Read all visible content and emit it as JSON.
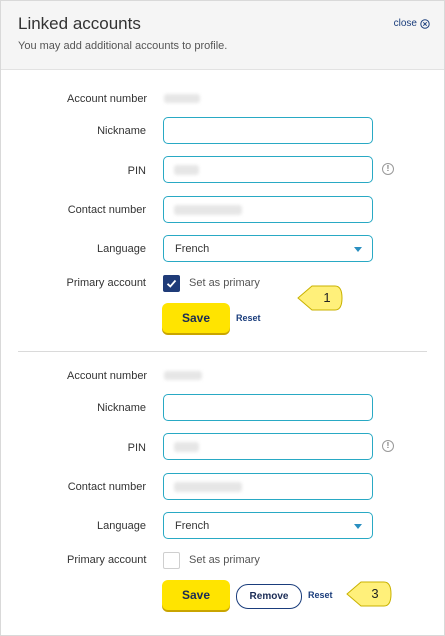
{
  "header": {
    "title": "Linked accounts",
    "subtitle": "You may add additional accounts to profile.",
    "close_label": "close"
  },
  "accounts": [
    {
      "account_number_label": "Account number",
      "nickname_label": "Nickname",
      "nickname_value": "",
      "pin_label": "PIN",
      "contact_label": "Contact number",
      "language_label": "Language",
      "language_value": "French",
      "primary_label": "Primary account",
      "primary_checked": true,
      "set_primary_label": "Set as primary",
      "save_label": "Save",
      "reset_label": "Reset"
    },
    {
      "account_number_label": "Account number",
      "nickname_label": "Nickname",
      "nickname_value": "",
      "pin_label": "PIN",
      "contact_label": "Contact number",
      "language_label": "Language",
      "language_value": "French",
      "primary_label": "Primary account",
      "primary_checked": false,
      "set_primary_label": "Set as primary",
      "save_label": "Save",
      "remove_label": "Remove",
      "reset_label": "Reset"
    }
  ],
  "callouts": [
    "1",
    "3"
  ],
  "colors": {
    "accent_border": "#29a9c4",
    "save_button": "#ffe400",
    "link": "#1a3d7c",
    "checkbox_checked": "#1f3b78",
    "callout_fill": "#fff07a"
  }
}
